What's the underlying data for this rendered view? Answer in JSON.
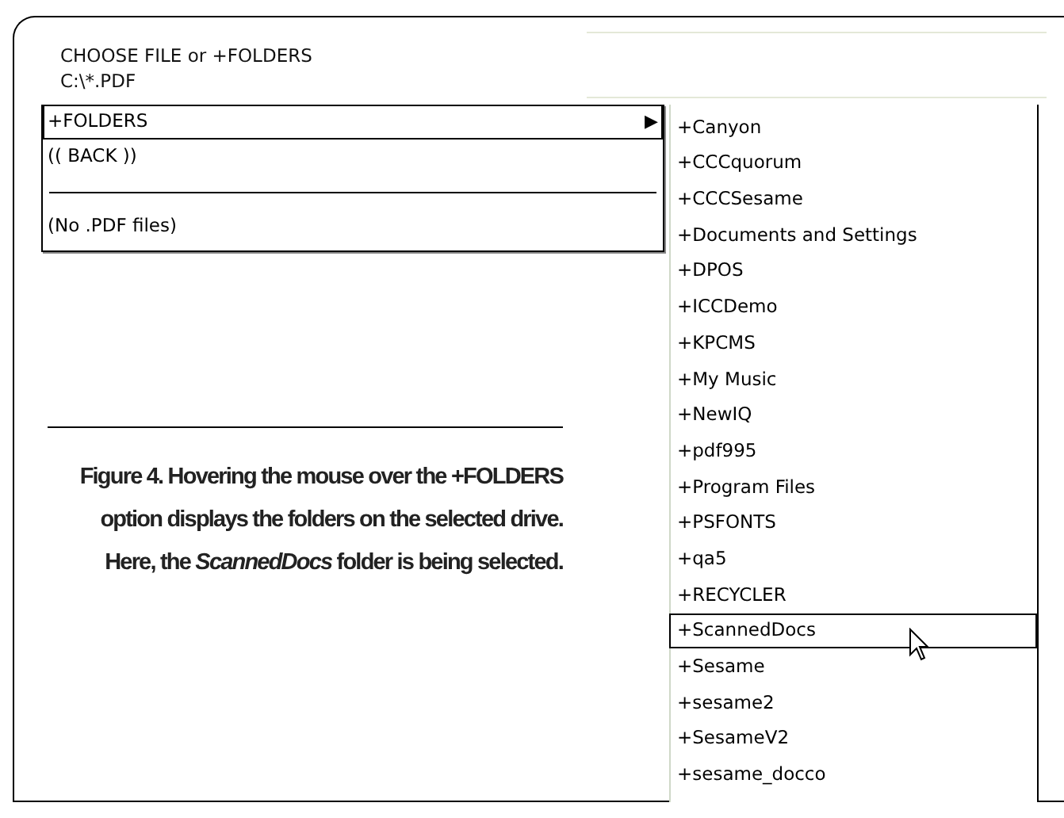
{
  "header": {
    "title": "CHOOSE FILE or +FOLDERS",
    "path": "C:\\*.PDF"
  },
  "menu": [
    {
      "kind": "submenu",
      "label": "+FOLDERS",
      "arrow": "▶",
      "selected": true
    },
    {
      "kind": "item",
      "label": "(( BACK ))",
      "selected": false
    },
    {
      "kind": "separator"
    },
    {
      "kind": "item",
      "label": "(No .PDF files)",
      "selected": false
    }
  ],
  "folders": [
    {
      "label": "+Canyon",
      "selected": false
    },
    {
      "label": "+CCCquorum",
      "selected": false
    },
    {
      "label": "+CCCSesame",
      "selected": false
    },
    {
      "label": "+Documents and Settings",
      "selected": false
    },
    {
      "label": "+DPOS",
      "selected": false
    },
    {
      "label": "+ICCDemo",
      "selected": false
    },
    {
      "label": "+KPCMS",
      "selected": false
    },
    {
      "label": "+My Music",
      "selected": false
    },
    {
      "label": "+NewIQ",
      "selected": false
    },
    {
      "label": "+pdf995",
      "selected": false
    },
    {
      "label": "+Program Files",
      "selected": false
    },
    {
      "label": "+PSFONTS",
      "selected": false
    },
    {
      "label": "+qa5",
      "selected": false
    },
    {
      "label": "+RECYCLER",
      "selected": false
    },
    {
      "label": "+ScannedDocs",
      "selected": true
    },
    {
      "label": "+Sesame",
      "selected": false
    },
    {
      "label": "+sesame2",
      "selected": false
    },
    {
      "label": "+SesameV2",
      "selected": false
    },
    {
      "label": "+sesame_docco",
      "selected": false
    }
  ],
  "caption": "Figure 4. Hovering the mouse over the **+FOLDERS** option displays the folders on the selected drive. Here, the *ScannedDocs* folder is being selected."
}
